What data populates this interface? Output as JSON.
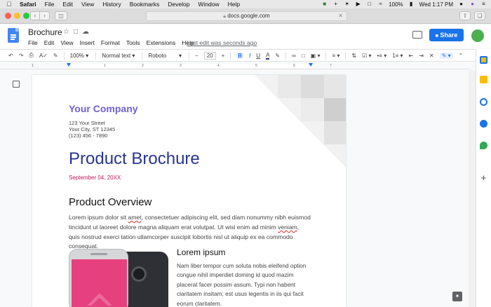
{
  "macos": {
    "menu": [
      "Safari",
      "File",
      "Edit",
      "View",
      "History",
      "Bookmarks",
      "Develop",
      "Window",
      "Help"
    ],
    "battery": "100%",
    "clock": "Wed 1:17 PM"
  },
  "safari": {
    "url": "docs.google.com"
  },
  "docs": {
    "title": "Brochure",
    "menu": [
      "File",
      "Edit",
      "View",
      "Insert",
      "Format",
      "Tools",
      "Extensions",
      "Help"
    ],
    "last_edit": "Last edit was seconds ago",
    "share_label": "Share"
  },
  "toolbar": {
    "zoom": "100%",
    "style": "Normal text",
    "font": "Roboto",
    "font_size": "20",
    "minus": "−",
    "plus": "+",
    "bold": "B",
    "italic": "I",
    "underline": "U",
    "text_color": "A"
  },
  "ruler": {
    "ticks": [
      "1",
      "1",
      "2",
      "3",
      "4",
      "5",
      "6",
      "7"
    ]
  },
  "document": {
    "company": "Your Company",
    "address": [
      "123 Your Street",
      "Your City, ST 12345",
      "(123) 456 - 7890"
    ],
    "product_title": "Product Brochure",
    "date": "September 04, 20XX",
    "overview_heading": "Product Overview",
    "overview_pre": "Lorem ipsum dolor sit ",
    "overview_err1": "amet",
    "overview_mid": ", consectetuer adipiscing elit, sed diam nonummy nibh euismod tincidunt ut laoreet dolore magna aliquam erat volutpat. Ut wisi enim ad minim ",
    "overview_err2": "veniam",
    "overview_post": ", quis nostrud exerci tation ullamcorper suscipit lobortis nisl ut aliquip ex ea commodo consequat.",
    "lorem_heading": "Lorem ipsum",
    "lorem_body": "Nam liber tempor cum soluta nobis eleifend option congue nihil imperdiet doming id quod mazim placerat facer possim assum. Typi non habent claritatem insitam; est usus legentis in iis qui facit eorum claritatem."
  },
  "colors": {
    "docs_blue": "#4285f4",
    "share_blue": "#1a73e8",
    "company_purple": "#6e5fd6",
    "title_navy": "#283593",
    "date_magenta": "#c2185b",
    "avatar_green": "#4caf50",
    "phone_pink": "#e6407f"
  },
  "icons": [
    "apple-icon",
    "star-icon",
    "folder-icon",
    "cloud-icon",
    "comment-icon",
    "lock-icon",
    "undo-icon",
    "redo-icon",
    "print-icon",
    "spellcheck-icon",
    "paint-format-icon",
    "link-icon",
    "image-icon",
    "align-icon",
    "outline-icon",
    "explore-icon"
  ]
}
